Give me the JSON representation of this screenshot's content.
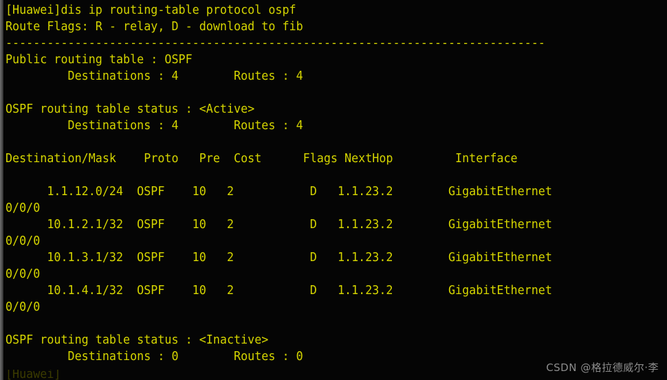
{
  "terminal": {
    "prompt_line": "[Huawei]dis ip routing-table protocol ospf",
    "colors": {
      "background": "#050505",
      "text": "#d4d400",
      "watermark": "#8c8c8c",
      "gutter": "#6e6e6e"
    },
    "lines": [
      "[Huawei]dis ip routing-table protocol ospf",
      "Route Flags: R - relay, D - download to fib",
      "------------------------------------------------------------------------------",
      "Public routing table : OSPF",
      "         Destinations : 4        Routes : 4",
      "",
      "OSPF routing table status : <Active>",
      "         Destinations : 4        Routes : 4",
      "",
      "Destination/Mask    Proto   Pre  Cost      Flags NextHop         Interface",
      "",
      "      1.1.12.0/24  OSPF    10   2           D   1.1.23.2        GigabitEthernet",
      "0/0/0",
      "      10.1.2.1/32  OSPF    10   2           D   1.1.23.2        GigabitEthernet",
      "0/0/0",
      "      10.1.3.1/32  OSPF    10   2           D   1.1.23.2        GigabitEthernet",
      "0/0/0",
      "      10.1.4.1/32  OSPF    10   2           D   1.1.23.2        GigabitEthernet",
      "0/0/0",
      "",
      "OSPF routing table status : <Inactive>",
      "         Destinations : 0        Routes : 0"
    ],
    "cursor_line": "[Huawei]",
    "command": "dis ip routing-table protocol ospf",
    "device_name": "Huawei",
    "flags_legend": {
      "R": "relay",
      "D": "download to fib"
    },
    "public_table": {
      "name": "Public routing table : OSPF",
      "destinations": "4",
      "routes": "4"
    },
    "active_table": {
      "status": "<Active>",
      "title": "OSPF routing table status : <Active>",
      "destinations": "4",
      "routes": "4"
    },
    "inactive_table": {
      "status": "<Inactive>",
      "title": "OSPF routing table status : <Inactive>",
      "destinations": "0",
      "routes": "0"
    },
    "table": {
      "headers": [
        "Destination/Mask",
        "Proto",
        "Pre",
        "Cost",
        "Flags",
        "NextHop",
        "Interface"
      ],
      "rows": [
        {
          "destination_mask": "1.1.12.0/24",
          "proto": "OSPF",
          "pre": "10",
          "cost": "2",
          "flags": "D",
          "nexthop": "1.1.23.2",
          "interface": "GigabitEthernet0/0/0"
        },
        {
          "destination_mask": "10.1.2.1/32",
          "proto": "OSPF",
          "pre": "10",
          "cost": "2",
          "flags": "D",
          "nexthop": "1.1.23.2",
          "interface": "GigabitEthernet0/0/0"
        },
        {
          "destination_mask": "10.1.3.1/32",
          "proto": "OSPF",
          "pre": "10",
          "cost": "2",
          "flags": "D",
          "nexthop": "1.1.23.2",
          "interface": "GigabitEthernet0/0/0"
        },
        {
          "destination_mask": "10.1.4.1/32",
          "proto": "OSPF",
          "pre": "10",
          "cost": "2",
          "flags": "D",
          "nexthop": "1.1.23.2",
          "interface": "GigabitEthernet0/0/0"
        }
      ]
    },
    "labels": {
      "destinations": "Destinations",
      "routes": "Routes"
    }
  },
  "watermark": {
    "text": "CSDN @格拉德威尔·李"
  }
}
